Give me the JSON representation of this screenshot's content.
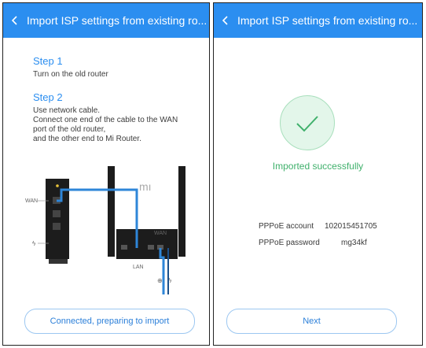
{
  "colors": {
    "accent": "#2b8ef0",
    "success": "#3fb06b"
  },
  "icons": {
    "back": "chevron-left-icon",
    "success": "checkmark-icon"
  },
  "left": {
    "title": "Import ISP settings from existing ro...",
    "step1_heading": "Step 1",
    "step1_text": "Turn on the old router",
    "step2_heading": "Step 2",
    "step2_lines": [
      "Use network cable.",
      "Connect one end of the cable to the WAN",
      "port of the old router,",
      "and the other end to Mi Router."
    ],
    "diagram": {
      "old_wan_label": "WAN",
      "mi_logo": "mı",
      "mi_wan_label": "WAN",
      "lan_label": "LAN"
    },
    "button_label": "Connected, preparing to import"
  },
  "right": {
    "title": "Import ISP settings from existing ro...",
    "status_text": "Imported successfully",
    "account_label": "PPPoE account",
    "account_value": "102015451705",
    "password_label": "PPPoE password",
    "password_value": "mg34kf",
    "button_label": "Next"
  }
}
